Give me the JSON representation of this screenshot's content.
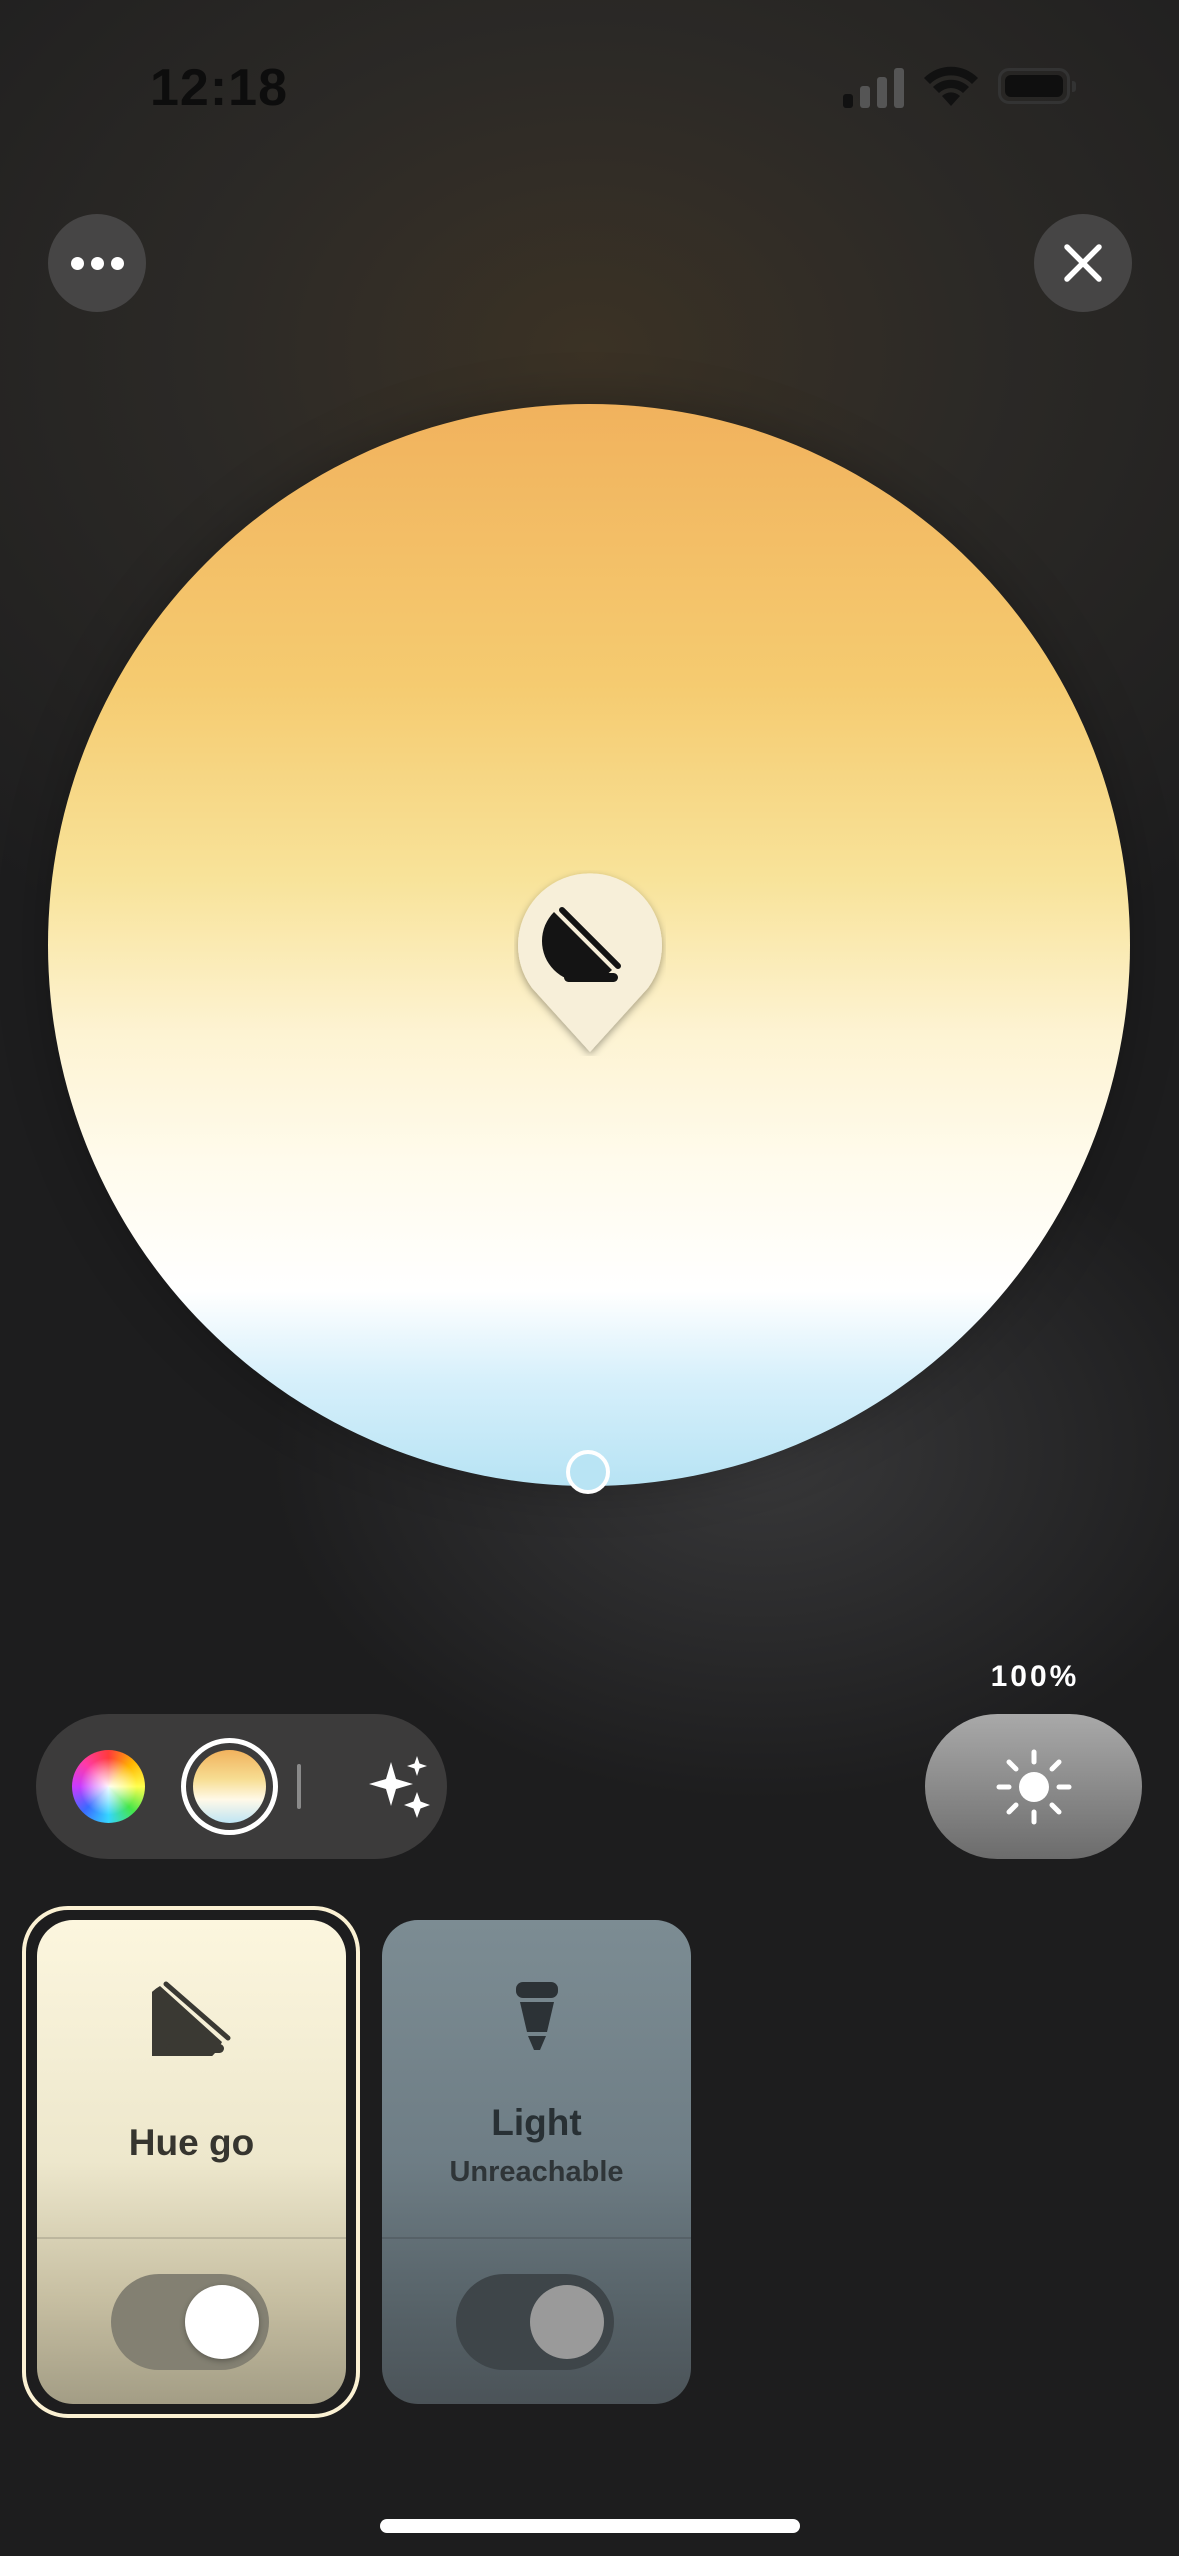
{
  "status_bar": {
    "time": "12:18"
  },
  "top_actions": {
    "more_icon": "ellipsis-icon",
    "close_icon": "close-icon"
  },
  "color_wheel": {
    "mode": "white-ambiance",
    "colors": {
      "warm": "#f1b25d",
      "neutral": "#ffffff",
      "cool": "#b7e3f4"
    }
  },
  "brightness": {
    "value": "100%",
    "icon": "sun-icon"
  },
  "mode_selector": {
    "items": [
      {
        "name": "color",
        "icon": "color-wheel-icon"
      },
      {
        "name": "white",
        "icon": "white-ambiance-icon",
        "selected": true
      },
      {
        "name": "scenes",
        "icon": "sparkles-icon"
      }
    ]
  },
  "lights": [
    {
      "name": "Hue go",
      "status": "",
      "icon": "hue-go-lamp-icon",
      "on": true,
      "selected": true
    },
    {
      "name": "Light",
      "status": "Unreachable",
      "icon": "bulb-icon",
      "on": true,
      "selected": false
    }
  ]
}
